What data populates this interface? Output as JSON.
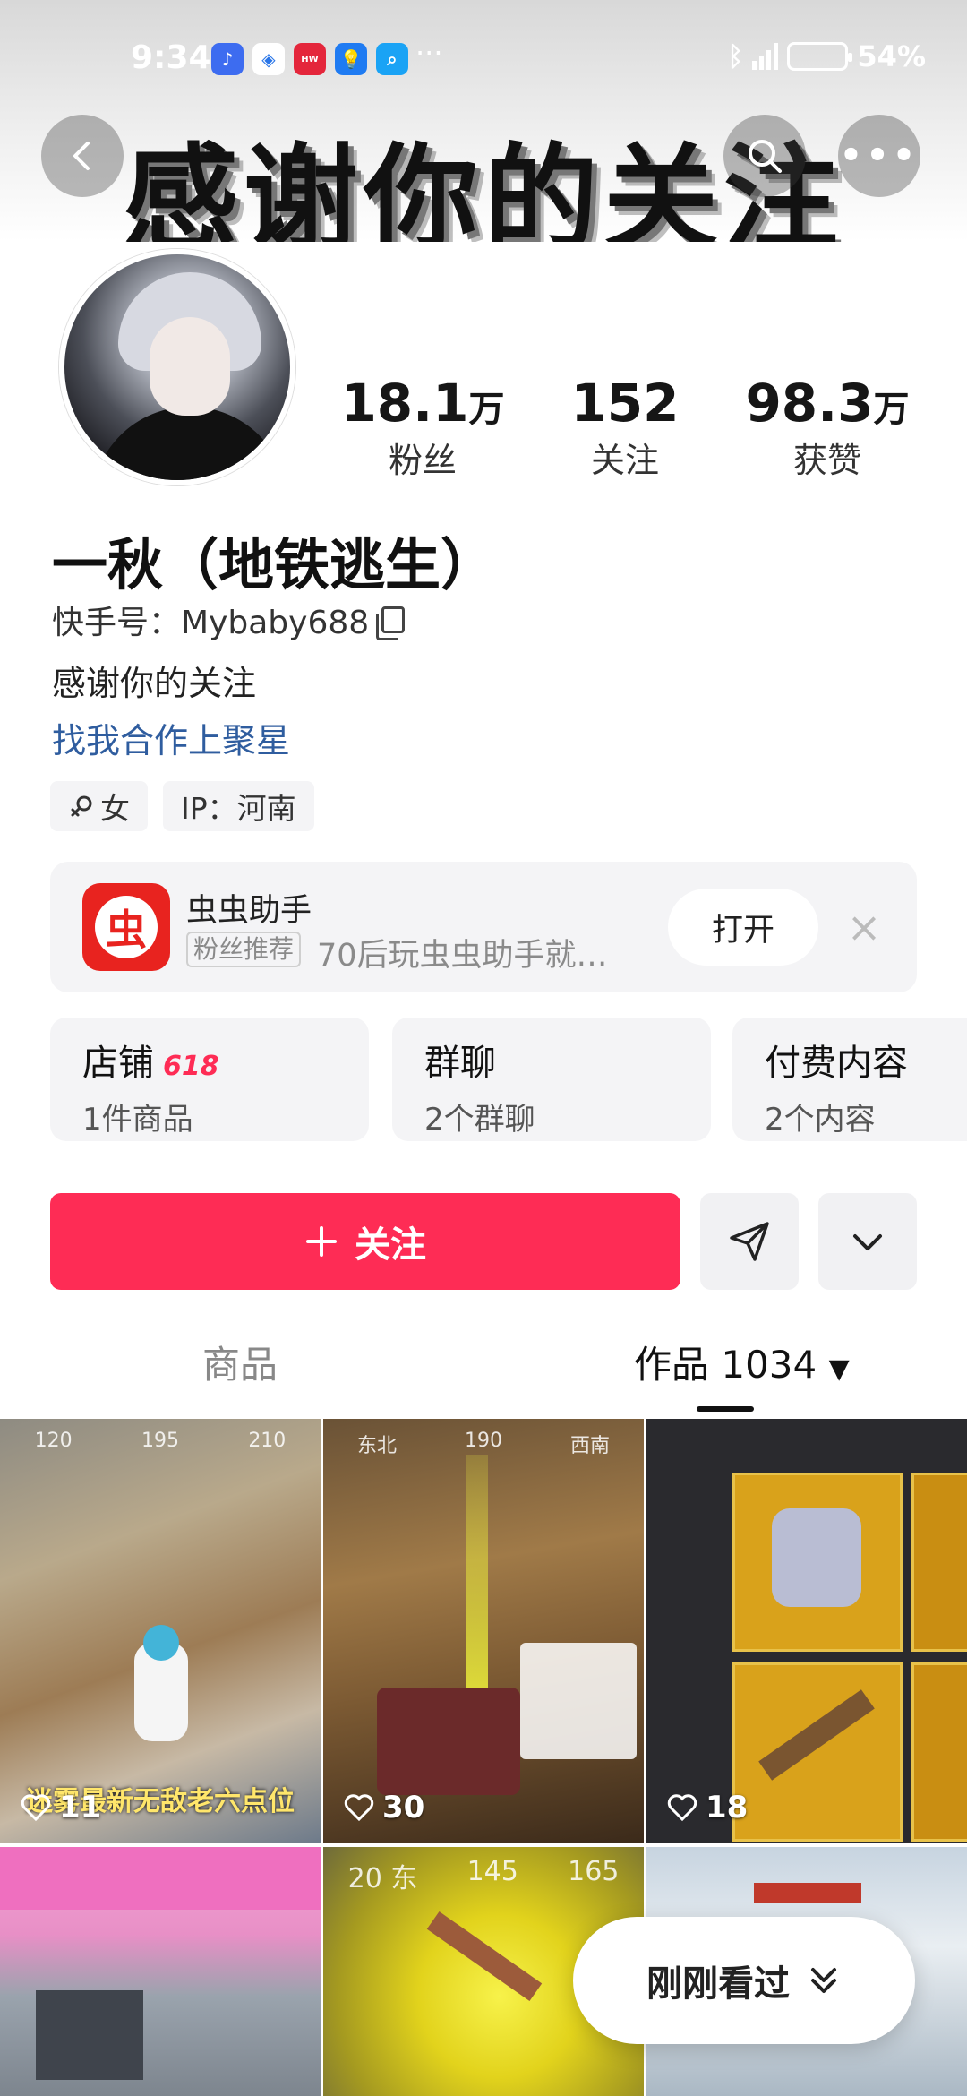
{
  "status_bar": {
    "time": "9:34",
    "more": "···",
    "battery": "54%"
  },
  "banner": {
    "text": "感谢你的关注"
  },
  "profile": {
    "name": "一秋（地铁逃生）",
    "kwai_id_label": "快手号：",
    "kwai_id": "Mybaby688",
    "bio": "感谢你的关注",
    "cooperation_link": "找我合作上聚星",
    "tags": {
      "gender": "女",
      "ip": "IP：河南"
    }
  },
  "stats": [
    {
      "value": "18.1",
      "unit": "万",
      "label": "粉丝"
    },
    {
      "value": "152",
      "unit": "",
      "label": "关注"
    },
    {
      "value": "98.3",
      "unit": "万",
      "label": "获赞"
    }
  ],
  "promo": {
    "app_name": "虫虫助手",
    "icon_char": "虫",
    "badge": "粉丝推荐",
    "description": "70后玩虫虫助手就…",
    "open_label": "打开"
  },
  "features": [
    {
      "title": "店铺",
      "badge": "618",
      "sub": "1件商品"
    },
    {
      "title": "群聊",
      "badge": "",
      "sub": "2个群聊"
    },
    {
      "title": "付费内容",
      "badge": "",
      "sub": "2个内容"
    }
  ],
  "actions": {
    "follow_label": "关注"
  },
  "tabs": {
    "goods": "商品",
    "works": "作品 1034"
  },
  "works": [
    {
      "likes": "11",
      "caption": "迷雾最新无敌老六点位"
    },
    {
      "likes": "30",
      "caption": ""
    },
    {
      "likes": "18",
      "caption": ""
    }
  ],
  "floating": {
    "label": "刚刚看过"
  },
  "colors": {
    "accent": "#fe2c55",
    "link": "#2f5d9f",
    "card_bg": "#f4f4f6"
  }
}
